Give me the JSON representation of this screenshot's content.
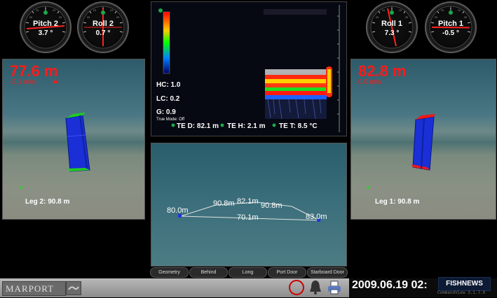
{
  "gauges": {
    "pitch2": {
      "title": "Pitch 2",
      "value": "3.7 °"
    },
    "roll2": {
      "title": "Roll 2",
      "value": "0.7 °"
    },
    "roll1": {
      "title": "Roll 1",
      "value": "7.3 °"
    },
    "pitch1": {
      "title": "Pitch 1",
      "value": "-0.5 °"
    },
    "scale_labels": [
      "20",
      "10",
      "0",
      "10",
      "20"
    ]
  },
  "left_panel": {
    "depth": "77.6 m",
    "speed": "-2.1 m/s",
    "leg": "Leg 2: 90.8 m"
  },
  "right_panel": {
    "depth": "82.8 m",
    "speed": "0.0 m/s",
    "leg": "Leg 1: 90.8 m"
  },
  "echogram": {
    "hc": "HC: 1.0",
    "lc": "LC: 0.2",
    "g": "G: 0.9",
    "mode": "True Mode: Off",
    "te_d": "TE D: 82.1 m",
    "te_h": "TE H: 2.1 m",
    "te_t": "TE T: 8.5 °C"
  },
  "geometry": {
    "labels": {
      "left_depth": "80.0m",
      "leg_left": "90.8m",
      "center": "82.1m",
      "leg_right": "90.8m",
      "spread": "70.1m",
      "right_depth": "83.0m"
    }
  },
  "tabs": [
    "Geometry",
    "Behind",
    "Long",
    "Port Door",
    "Starboard Door"
  ],
  "bottom": {
    "logo": "MARPORT",
    "datetime": "2009.06.19 02:",
    "watermark": "FISHNEWS",
    "version": "CommandView 3.1.7.0"
  },
  "colors": {
    "alert_red": "#ff1a1a",
    "door_blue": "#1a2fd6",
    "door_green": "#22cc22"
  }
}
